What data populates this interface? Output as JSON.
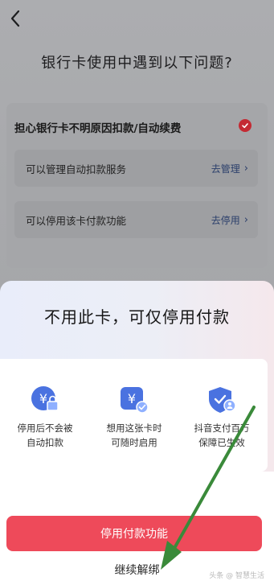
{
  "page": {
    "back_icon": "chevron-left-icon",
    "title": "银行卡使用中遇到以下问题?"
  },
  "problem": {
    "heading": "担心银行卡不明原因扣款/自动续费",
    "check_icon": "check-circle-icon",
    "options": [
      {
        "label": "可以管理自动扣款服务",
        "action": "去管理"
      },
      {
        "label": "可以停用该卡付款功能",
        "action": "去停用"
      }
    ]
  },
  "sheet": {
    "title": "不用此卡，可仅停用付款",
    "benefits": [
      {
        "icon": "yuan-lock-shield-icon",
        "line1": "停用后不会被",
        "line2": "自动扣款"
      },
      {
        "icon": "yuan-card-check-icon",
        "line1": "想用这张卡时",
        "line2": "可随时启用"
      },
      {
        "icon": "shield-user-icon",
        "line1": "抖音支付百万",
        "line2": "保障已生效"
      }
    ],
    "primary_button": "停用付款功能",
    "secondary_link": "继续解绑",
    "watermark": "头条 @ 智慧生活"
  },
  "colors": {
    "accent_red": "#ee4a5a",
    "check_red": "#c42a33",
    "icon_blue": "#4a72e0",
    "annotation_green": "#3a8a3a"
  }
}
